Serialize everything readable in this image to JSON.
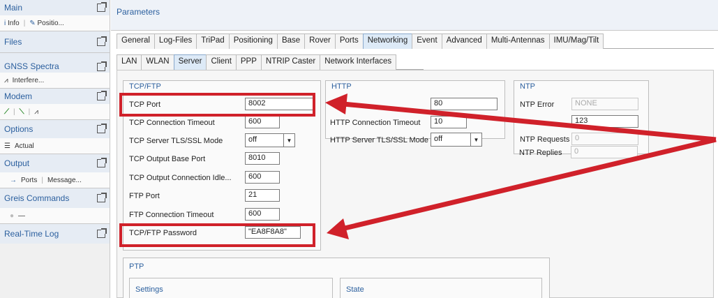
{
  "sidebar": {
    "sections": [
      {
        "title": "Main",
        "items": [
          "Info",
          "Positio..."
        ]
      },
      {
        "title": "Files",
        "items": []
      },
      {
        "title": "GNSS Spectra",
        "items": [
          "Interfere..."
        ]
      },
      {
        "title": "Modem",
        "items": []
      },
      {
        "title": "Options",
        "items": [
          "Actual"
        ]
      },
      {
        "title": "Output",
        "items": [
          "Ports",
          "Message..."
        ]
      },
      {
        "title": "Greis Commands",
        "items": [
          "—"
        ]
      },
      {
        "title": "Real-Time Log",
        "items": []
      }
    ]
  },
  "main": {
    "title": "Parameters",
    "tabs": [
      "General",
      "Log-Files",
      "TriPad",
      "Positioning",
      "Base",
      "Rover",
      "Ports",
      "Networking",
      "Event",
      "Advanced",
      "Multi-Antennas",
      "IMU/Mag/Tilt"
    ],
    "subtabs": [
      "LAN",
      "WLAN",
      "Server",
      "Client",
      "PPP",
      "NTRIP Caster",
      "Network Interfaces"
    ]
  },
  "tcp": {
    "title": "TCP/FTP",
    "tcp_port_label": "TCP Port",
    "tcp_port": "8002",
    "timeout_label": "TCP Connection Timeout",
    "timeout": "600",
    "tls_label": "TCP Server TLS/SSL Mode",
    "tls": "off",
    "base_port_label": "TCP Output Base Port",
    "base_port": "8010",
    "idle_label": "TCP Output Connection Idle...",
    "idle": "600",
    "ftp_port_label": "FTP Port",
    "ftp_port": "21",
    "ftp_timeout_label": "FTP Connection Timeout",
    "ftp_timeout": "600",
    "password_label": "TCP/FTP Password",
    "password": "\"EA8F8A8\""
  },
  "http": {
    "title": "HTTP",
    "port": "80",
    "timeout_label": "HTTP Connection Timeout",
    "timeout": "10",
    "tls_label": "HTTP Server TLS/SSL Mode",
    "tls": "off"
  },
  "ntp": {
    "title": "NTP",
    "error_label": "NTP Error",
    "error": "NONE",
    "port": "123",
    "requests_label": "NTP Requests",
    "requests": "0",
    "replies_label": "NTP Replies",
    "replies": "0"
  },
  "ptp": {
    "title": "PTP",
    "settings": "Settings",
    "state": "State"
  },
  "colors": {
    "accent": "#2b5f9e",
    "highlight": "#d0212a"
  }
}
